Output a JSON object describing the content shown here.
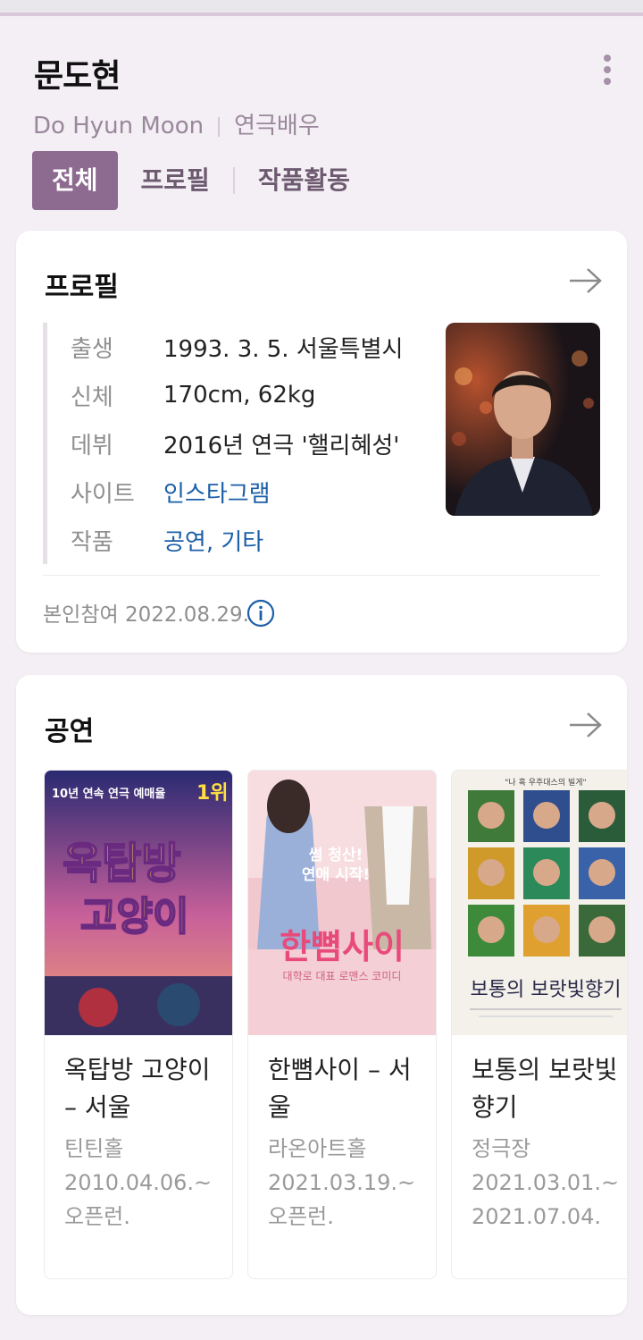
{
  "header": {
    "title": "문도현",
    "name_en": "Do Hyun Moon",
    "occupation": "연극배우"
  },
  "tabs": [
    {
      "label": "전체",
      "active": true
    },
    {
      "label": "프로필",
      "active": false
    },
    {
      "label": "작품활동",
      "active": false
    }
  ],
  "profile": {
    "title": "프로필",
    "rows": [
      {
        "key": "출생",
        "value": "1993. 3. 5. 서울특별시"
      },
      {
        "key": "신체",
        "value": "170cm, 62kg"
      },
      {
        "key": "데뷔",
        "value": "2016년 연극 '핼리혜성'"
      },
      {
        "key": "사이트",
        "value": "인스타그램"
      },
      {
        "key": "작품",
        "value": "공연, 기타"
      }
    ],
    "footer": "본인참여 2022.08.29."
  },
  "performances": {
    "title": "공연",
    "items": [
      {
        "name": "옥탑방 고양이 – 서울",
        "venue": "틴틴홀",
        "period": "2010.04.06.~",
        "status": "오픈런.",
        "poster_text": [
          "10년 연속 연극 예매율",
          "1위",
          "옥탑방",
          "고양이"
        ]
      },
      {
        "name": "한뼘사이 – 서울",
        "venue": "라온아트홀",
        "period": "2021.03.19.~",
        "status": "오픈런.",
        "poster_text": [
          "썸 청산!",
          "연애 시작!",
          "한뼘사이",
          "대학로 대표 로맨스 코미디"
        ]
      },
      {
        "name": "보통의 보랏빛 향기",
        "venue": "정극장",
        "period": "2021.03.01.~",
        "status": "2021.07.04.",
        "poster_text": [
          "\"나 혹 우주대스의 빌게\"",
          "보통의 보랏빛향기"
        ]
      }
    ]
  },
  "colors": {
    "accent": "#8d6a8f",
    "link": "#1b5fa8",
    "page_bg": "#f3eff4"
  }
}
